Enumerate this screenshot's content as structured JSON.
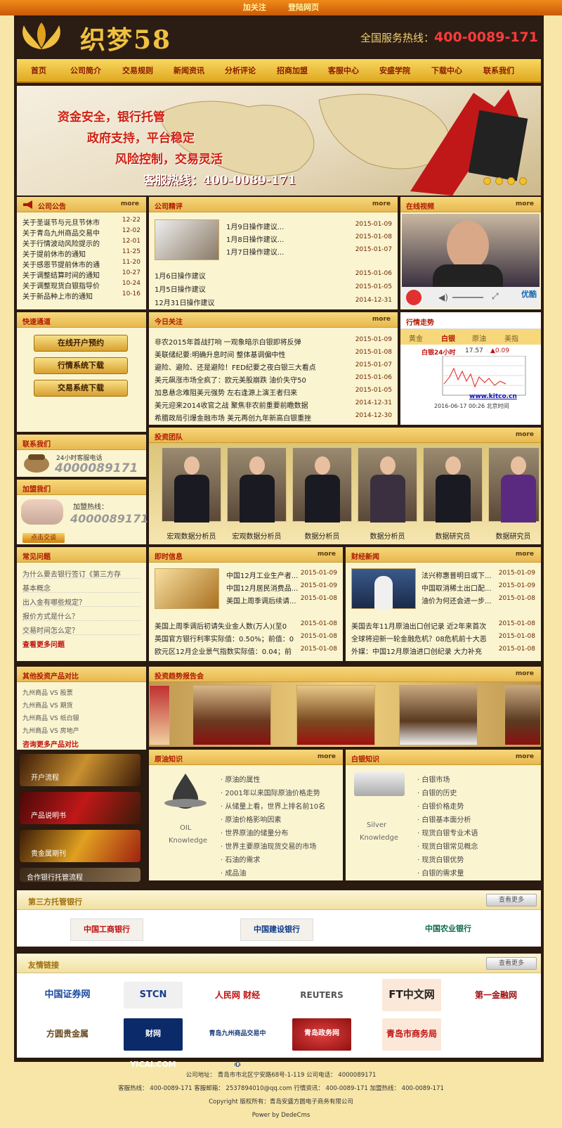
{
  "topbar": {
    "links": [
      "加关注",
      "登陆网页"
    ]
  },
  "header": {
    "logo_text": "织梦58",
    "hotline_label": "全国服务热线：",
    "hotline_number": "400-0089-171"
  },
  "nav": {
    "items": [
      "首页",
      "公司简介",
      "交易规则",
      "新闻资讯",
      "分析评论",
      "招商加盟",
      "客服中心",
      "安盛学院",
      "下载中心",
      "联系我们"
    ]
  },
  "banner": {
    "lines": [
      "资金安全，银行托管",
      "政府支持，平台稳定",
      "风险控制，交易灵活",
      "客服热线：400-0089-171"
    ]
  },
  "notice": {
    "title": "公司公告",
    "more": "more",
    "items": [
      {
        "t": "关于圣诞节与元旦节休市",
        "d": "12-22"
      },
      {
        "t": "关于青岛九州商品交易中",
        "d": "12-02"
      },
      {
        "t": "关于行情波动风险提示的",
        "d": "12-01"
      },
      {
        "t": "关于提前休市的通知",
        "d": "11-25"
      },
      {
        "t": "关于感恩节提前休市的通",
        "d": "11-20"
      },
      {
        "t": "关于调整结算时间的通知",
        "d": "10-27"
      },
      {
        "t": "关于调整现货白银指导价",
        "d": "10-24"
      },
      {
        "t": "关于新品种上市的通知",
        "d": "10-16"
      }
    ]
  },
  "review": {
    "title": "公司精评",
    "more": "more",
    "top": [
      {
        "t": "1月9日操作建议...",
        "d": "2015-01-09"
      },
      {
        "t": "1月8日操作建议...",
        "d": "2015-01-08"
      },
      {
        "t": "1月7日操作建议...",
        "d": "2015-01-07"
      }
    ],
    "items": [
      {
        "t": "1月6日操作建议",
        "d": "2015-01-06"
      },
      {
        "t": "1月5日操作建议",
        "d": "2015-01-05"
      },
      {
        "t": "12月31日操作建议",
        "d": "2014-12-31"
      }
    ]
  },
  "video": {
    "title": "在线视频",
    "more": "more",
    "brand": "优酷"
  },
  "quick": {
    "title": "快速通道",
    "buttons": [
      "在线开户预约",
      "行情系统下载",
      "交易系统下载"
    ]
  },
  "today": {
    "title": "今日关注",
    "more": "more",
    "items": [
      {
        "t": "非农2015年首战打响 一观象暗示白银即将反弹",
        "d": "2015-01-09"
      },
      {
        "t": "美联储纪要:明确升息时间 整体基调偏中性",
        "d": "2015-01-08"
      },
      {
        "t": "避险、避险、还是避险！FED纪要之夜白银三大看点",
        "d": "2015-01-07"
      },
      {
        "t": "美元飙涨市场全疯了：欧元美股崩跌 油价失守50",
        "d": "2015-01-06"
      },
      {
        "t": "加息悬念难阻美元强势 左右逢源上演王者归来",
        "d": "2015-01-05"
      },
      {
        "t": "美元迎来2014收官之战 聚焦非农前重要前瞻数据",
        "d": "2014-12-31"
      },
      {
        "t": "希腊政局引爆金融市场 美元再创九年新高白银重挫",
        "d": "2014-12-30"
      }
    ]
  },
  "trend": {
    "title": "行情走势",
    "tabs": [
      "黄金",
      "白银",
      "原油",
      "美指"
    ],
    "chart_label": "白银24小时",
    "price": "17.57",
    "change": "▲0.09",
    "site": "www.kitco.cn",
    "time": "2016-06-17 00:26 北京时间"
  },
  "contact": {
    "title": "联系我们",
    "label": "24小时客服电话",
    "phone": "4000089171"
  },
  "join": {
    "title": "加盟我们",
    "label": "加盟热线：",
    "phone": "4000089171",
    "btn": "点击交谈"
  },
  "team": {
    "title": "投资团队",
    "more": "more",
    "members": [
      "宏观数据分析员",
      "宏观数据分析员",
      "数据分析员",
      "数据分析员",
      "数据研究员",
      "数据研究员"
    ]
  },
  "faq": {
    "title": "常见问题",
    "items": [
      "为什么要去银行签订《第三方存",
      "基本概念",
      "出入金有哪些规定？",
      "报价方式是什么？",
      "交易时间怎么定？"
    ],
    "more": "查看更多问题"
  },
  "instant": {
    "title": "即时信息",
    "more": "more",
    "top": [
      {
        "t": "中国12月工业生产者...",
        "d": "2015-01-09"
      },
      {
        "t": "中国12月居民消费品...",
        "d": "2015-01-09"
      },
      {
        "t": "美国上周季调后续请...",
        "d": "2015-01-08"
      }
    ],
    "items": [
      {
        "t": "美国上周季调后初请失业金人数(万人)(至0",
        "d": "2015-01-08"
      },
      {
        "t": "英国官方银行利率实际值：0.50%；前值：0",
        "d": "2015-01-08"
      },
      {
        "t": "欧元区12月企业景气指数实际值：0.04；前",
        "d": "2015-01-08"
      }
    ]
  },
  "finance": {
    "title": "财经新闻",
    "more": "more",
    "top": [
      {
        "t": "法兴称惠普明日或下...",
        "d": "2015-01-09"
      },
      {
        "t": "中国取消稀土出口配...",
        "d": "2015-01-09"
      },
      {
        "t": "油价为何还会进一步...",
        "d": "2015-01-08"
      }
    ],
    "items": [
      {
        "t": "美国去年11月原油出口创记录 近2年来首次",
        "d": "2015-01-08"
      },
      {
        "t": "全球将迎新一轮金融危机？08危机前十大恶",
        "d": "2015-01-08"
      },
      {
        "t": "外媒：中国12月原油进口创纪录 大力补充",
        "d": "2015-01-08"
      }
    ]
  },
  "compare": {
    "title": "其他投资产品对比",
    "items": [
      "九州商品 VS 股票",
      "九州商品 VS 期货",
      "九州商品 VS 纸白银",
      "九州商品 VS 房地产"
    ],
    "more": "咨询更多产品对比"
  },
  "report": {
    "title": "投资趋势报告会",
    "more": "more"
  },
  "side_banners": [
    "开户流程",
    "产品说明书",
    "贵金属期刊",
    "合作银行托管流程"
  ],
  "oil": {
    "title": "原油知识",
    "more": "more",
    "caption": [
      "OIL",
      "Knowledge"
    ],
    "items": [
      "原油的属性",
      "2001年以来国际原油价格走势",
      "从储量上看，世界上排名前10名",
      "原油价格影响因素",
      "世界原油的储量分布",
      "世界主要原油现货交易的市场",
      "石油的需求",
      "成品油"
    ]
  },
  "silver": {
    "title": "白银知识",
    "more": "more",
    "caption": [
      "Silver",
      "Knowledge"
    ],
    "items": [
      "白银市场",
      "白银的历史",
      "白银价格走势",
      "白银基本面分析",
      "现货白银专业术语",
      "现货白银常见概念",
      "现货白银优势",
      "白银的需求量"
    ]
  },
  "banks": {
    "title": "第三方托管银行",
    "more": "查看更多",
    "items": [
      "中国工商银行",
      "中国建设银行",
      "中国农业银行"
    ]
  },
  "links": {
    "title": "友情链接",
    "more": "查看更多",
    "row1": [
      "中国证券网",
      "STCN",
      "人民网 财经",
      "REUTERS",
      "FT中文网",
      "第一金融网"
    ],
    "row2": [
      "方圆贵金属",
      "财网 YICAI.COM",
      "青岛九州商品交易中心",
      "青岛政务网",
      "青岛市商务局"
    ]
  },
  "footer": {
    "l1": "公司地址： 青岛市市北区宁安路68号-1-119    公司电话： 4000089171",
    "l2": "客服热线： 400-0089-171   客服邮箱： 2537894010@qq.com   行情资讯： 400-0089-171   加盟热线： 400-0089-171",
    "l3": "Copyright 版权所有：青岛安盛方圆电子商务有限公司",
    "l4": "Power by DedeCms"
  },
  "colors": {
    "gold": "#e8b850",
    "red": "#b01800",
    "frame": "#2a1a10",
    "bg": "#f7e6a8"
  }
}
